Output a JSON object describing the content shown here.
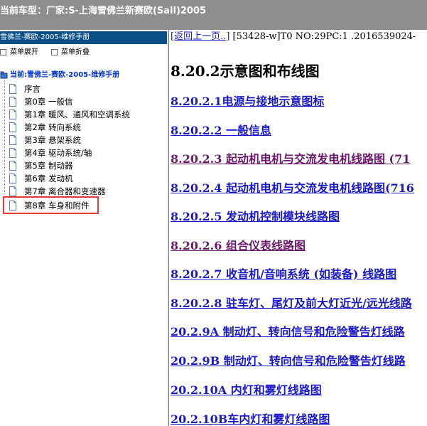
{
  "titlebar": {
    "text": "当前车型：厂家:S-上海雪佛兰新赛欧(Sail)2005"
  },
  "sidebar": {
    "header": "雪佛兰-赛欧-2005-维修手册",
    "expand_label": "菜单展开",
    "collapse_label": "菜单折叠",
    "root_label": "当前:雪佛兰-赛欧-2005-维修手册",
    "items": [
      {
        "label": "序言"
      },
      {
        "label": "第0章 一般信"
      },
      {
        "label": "第1章 暖风、通风和空调系统"
      },
      {
        "label": "第2章 转向系统"
      },
      {
        "label": "第3章 悬架系统"
      },
      {
        "label": "第4章 驱动系统/轴"
      },
      {
        "label": "第5章 制动器"
      },
      {
        "label": "第6章 发动机"
      },
      {
        "label": "第7章 离合器和变速器"
      },
      {
        "label": "第8章 车身和附件"
      }
    ],
    "selected_item": "第8章 车身和附件"
  },
  "content": {
    "back_link": "[返回上一页..]",
    "doc_info": " [53428-w]T0 NO:29PC:1 .2016539024-",
    "section_title": "8.20.2示意图和布线图",
    "links": [
      {
        "text": "8.20.2.1电源与接地示意图标",
        "visited": false
      },
      {
        "text": "8.20.2.2 一般信息",
        "visited": false
      },
      {
        "text": "8.20.2.3 起动机电机与交流发电机线路图 (71",
        "visited": true
      },
      {
        "text": "8.20.2.4 起动机电机与交流发电机线路图(716",
        "visited": false
      },
      {
        "text": "8.20.2.5 发动机控制模块线路图",
        "visited": false
      },
      {
        "text": "8.20.2.6 组合仪表线路图",
        "visited": true
      },
      {
        "text": "8.20.2.7 收音机/音响系统 (如装备) 线路图",
        "visited": false
      },
      {
        "text": "8.20.2.8 驻车灯、尾灯及前大灯近光/远光线路",
        "visited": false
      },
      {
        "text": "20.2.9A 制动灯、转向信号和危险警告灯线路",
        "visited": false
      },
      {
        "text": "20.2.9B 制动灯、转向信号和危险警告灯线路",
        "visited": false
      },
      {
        "text": "20.2.10A 内灯和雾灯线路图",
        "visited": false
      },
      {
        "text": "20.2.10B车内灯和雾灯线路图",
        "visited": false
      }
    ]
  },
  "colors": {
    "titlebar_bg": "#8e8e8e",
    "sidebar_header_bg": "#0a4f86",
    "link": "#1a1ac8",
    "visited_link": "#6b1a6b",
    "selection_border": "#e23a3a"
  }
}
